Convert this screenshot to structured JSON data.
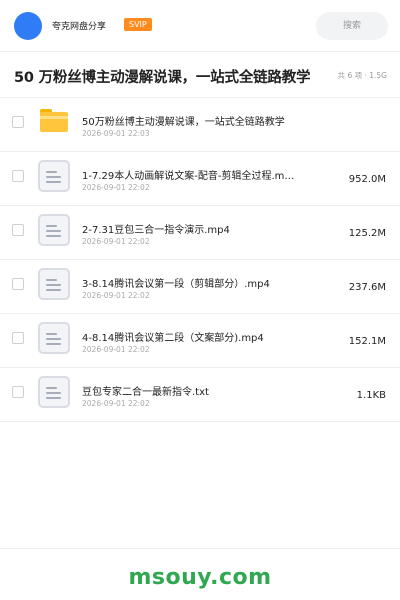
{
  "header": {
    "share_name": "夸克网盘分享",
    "badge": "SVIP",
    "search_placeholder": "搜索"
  },
  "title_bar": {
    "title": "50 万粉丝博主动漫解说课，一站式全链路教学",
    "summary": "共 6 项 · 1.5G"
  },
  "files": [
    {
      "type": "folder",
      "icon": "folder-icon",
      "name": "50万粉丝博主动漫解说课，一站式全链路教学",
      "date": "2026-09-01 22:03",
      "size": ""
    },
    {
      "type": "file",
      "icon": "file-icon",
      "name": "1-7.29本人动画解说文案-配音-剪辑全过程.m…",
      "date": "2026-09-01 22:02",
      "size": "952.0M"
    },
    {
      "type": "file",
      "icon": "file-icon",
      "name": "2-7.31豆包三合一指令演示.mp4",
      "date": "2026-09-01 22:02",
      "size": "125.2M"
    },
    {
      "type": "file",
      "icon": "file-icon",
      "name": "3-8.14腾讯会议第一段（剪辑部分）.mp4",
      "date": "2026-09-01 22:02",
      "size": "237.6M"
    },
    {
      "type": "file",
      "icon": "file-icon",
      "name": "4-8.14腾讯会议第二段（文案部分).mp4",
      "date": "2026-09-01 22:02",
      "size": "152.1M"
    },
    {
      "type": "file",
      "icon": "file-icon",
      "name": "豆包专家二合一最新指令.txt",
      "date": "2026-09-01 22:02",
      "size": "1.1KB"
    }
  ],
  "footer": {
    "watermark": "msouy.com"
  },
  "colors": {
    "accent_blue": "#2f7cf6",
    "badge_orange": "#ff8a1e",
    "folder_yellow": "#ffc53d",
    "watermark_green": "#2fa84f"
  }
}
